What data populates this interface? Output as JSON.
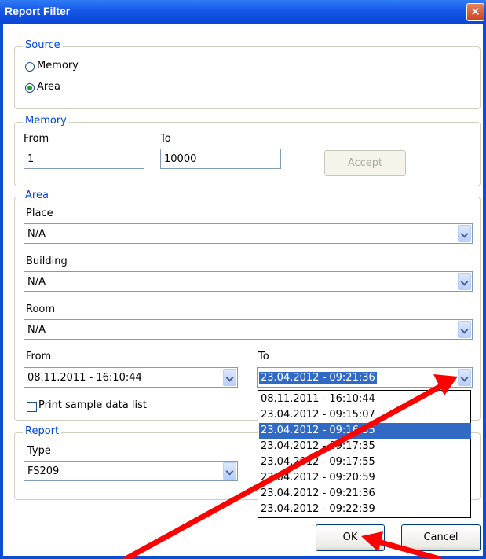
{
  "window": {
    "title": "Report Filter",
    "close_glyph": "✕"
  },
  "source": {
    "legend": "Source",
    "options": [
      {
        "label": "Memory",
        "selected": false
      },
      {
        "label": "Area",
        "selected": true
      }
    ]
  },
  "memory": {
    "legend": "Memory",
    "from_label": "From",
    "to_label": "To",
    "from_value": "1",
    "to_value": "10000",
    "accept_label": "Accept"
  },
  "area": {
    "legend": "Area",
    "place_label": "Place",
    "place_value": "N/A",
    "building_label": "Building",
    "building_value": "N/A",
    "room_label": "Room",
    "room_value": "N/A",
    "from_label": "From",
    "from_value": "08.11.2011 - 16:10:44",
    "to_label": "To",
    "to_value": "23.04.2012 - 09:21:36",
    "print_label": "Print sample data list",
    "to_options": [
      "08.11.2011 - 16:10:44",
      "23.04.2012 - 09:15:07",
      "23.04.2012 - 09:16:35",
      "23.04.2012 - 09:17:35",
      "23.04.2012 - 09:17:55",
      "23.04.2012 - 09:20:59",
      "23.04.2012 - 09:21:36",
      "23.04.2012 - 09:22:39"
    ],
    "highlighted_option_index": 2
  },
  "report": {
    "legend": "Report",
    "type_label": "Type",
    "type_value": "FS209"
  },
  "buttons": {
    "ok": "OK",
    "cancel": "Cancel"
  },
  "annotation_color": "#ff0000"
}
